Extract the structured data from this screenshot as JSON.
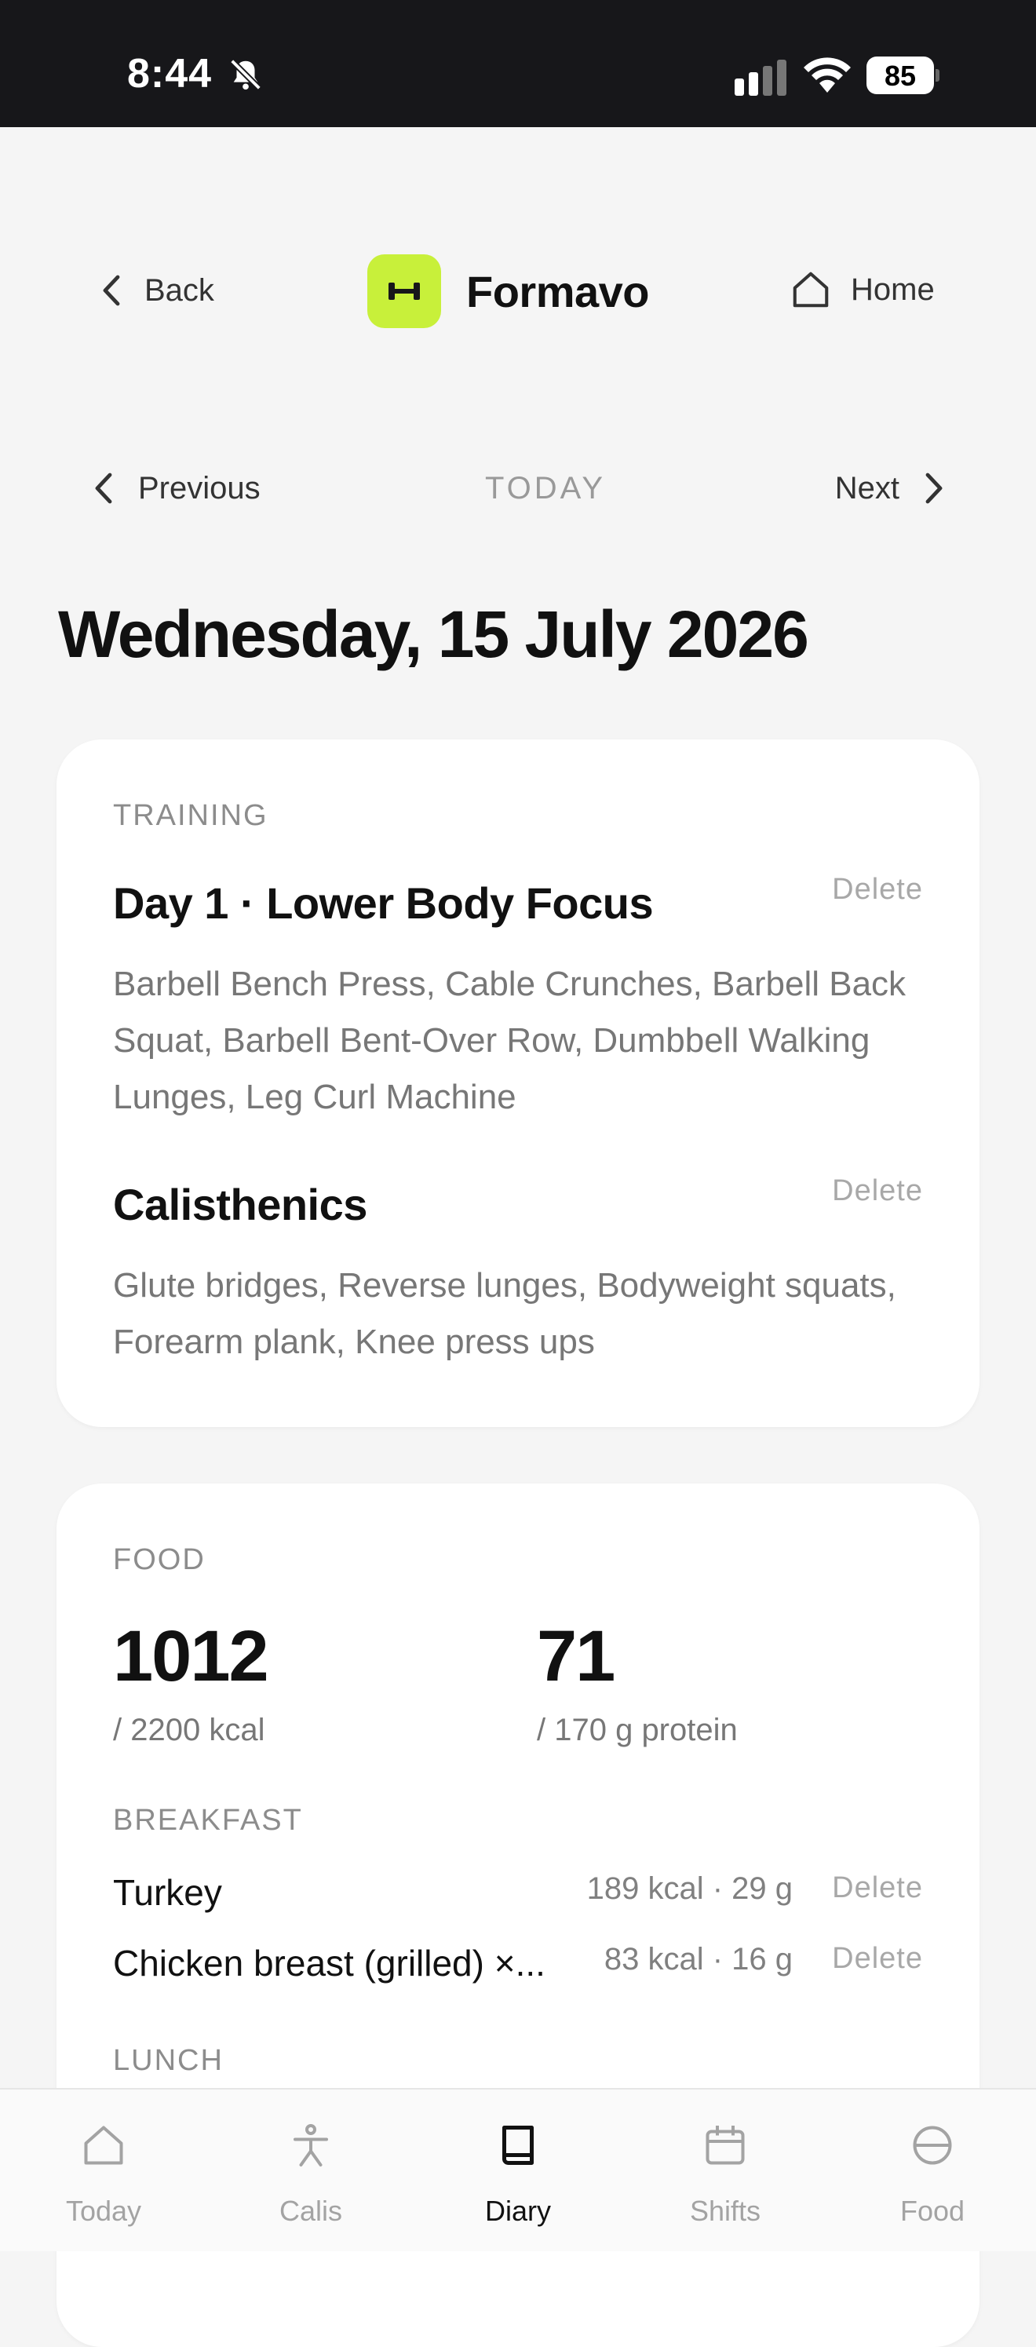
{
  "status_bar": {
    "time": "8:44",
    "battery": "85"
  },
  "header": {
    "back_label": "Back",
    "app_name": "Formavo",
    "home_label": "Home"
  },
  "day_nav": {
    "previous_label": "Previous",
    "today_label": "TODAY",
    "next_label": "Next"
  },
  "page_title": "Wednesday, 15 July 2026",
  "training": {
    "section_label": "TRAINING",
    "workouts": [
      {
        "title": "Day 1 · Lower Body Focus",
        "delete_label": "Delete",
        "exercises": "Barbell Bench Press, Cable Crunches, Barbell Back Squat, Barbell Bent-Over Row, Dumbbell Walking Lunges, Leg Curl Machine"
      },
      {
        "title": "Calisthenics",
        "delete_label": "Delete",
        "exercises": "Glute bridges, Reverse lunges, Bodyweight squats, Forearm plank, Knee press ups"
      }
    ]
  },
  "food": {
    "section_label": "FOOD",
    "calories": "1012",
    "calories_goal": "/ 2200 kcal",
    "protein": "71",
    "protein_goal": "/ 170 g protein",
    "meals": [
      {
        "label": "BREAKFAST",
        "items": [
          {
            "name": "Turkey",
            "macros": "189 kcal · 29 g",
            "delete_label": "Delete"
          },
          {
            "name": "Chicken breast (grilled) ×...",
            "macros": "83 kcal · 16 g",
            "delete_label": "Delete"
          }
        ]
      },
      {
        "label": "LUNCH",
        "items": []
      }
    ]
  },
  "tabbar": {
    "tabs": [
      {
        "label": "Today",
        "icon": "home-icon",
        "active": false
      },
      {
        "label": "Calis",
        "icon": "person-icon",
        "active": false
      },
      {
        "label": "Diary",
        "icon": "book-icon",
        "active": true
      },
      {
        "label": "Shifts",
        "icon": "calendar-icon",
        "active": false
      },
      {
        "label": "Food",
        "icon": "food-icon",
        "active": false
      }
    ]
  },
  "colors": {
    "accent": "#c8f03a",
    "status_bar": "#17171a",
    "background": "#f5f5f5"
  }
}
